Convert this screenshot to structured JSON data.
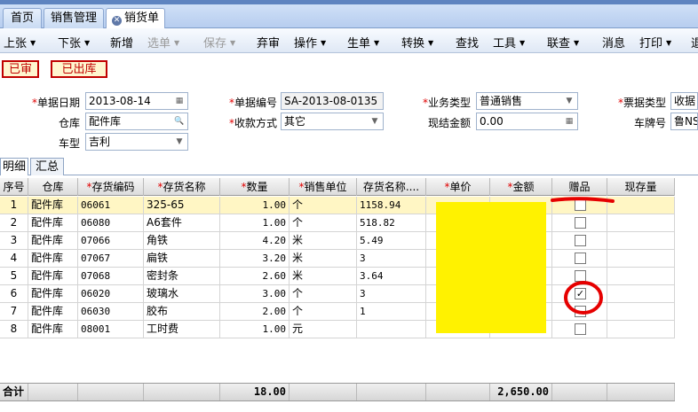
{
  "tabs": [
    {
      "label": "首页"
    },
    {
      "label": "销售管理"
    },
    {
      "label": "销货单"
    }
  ],
  "toolbar": [
    {
      "label": "上张",
      "dropdown": true,
      "disabled": false
    },
    {
      "label": "下张",
      "dropdown": true,
      "disabled": false
    },
    {
      "label": "新增",
      "dropdown": false,
      "disabled": false
    },
    {
      "label": "选单",
      "dropdown": true,
      "disabled": true
    },
    {
      "label": "保存",
      "dropdown": true,
      "disabled": true
    },
    {
      "label": "弃审",
      "dropdown": false,
      "disabled": false
    },
    {
      "label": "操作",
      "dropdown": true,
      "disabled": false
    },
    {
      "label": "生单",
      "dropdown": true,
      "disabled": false
    },
    {
      "label": "转换",
      "dropdown": true,
      "disabled": false
    },
    {
      "label": "查找",
      "dropdown": false,
      "disabled": false
    },
    {
      "label": "工具",
      "dropdown": true,
      "disabled": false
    },
    {
      "label": "联查",
      "dropdown": true,
      "disabled": false
    },
    {
      "label": "消息",
      "dropdown": false,
      "disabled": false
    },
    {
      "label": "打印",
      "dropdown": true,
      "disabled": false
    },
    {
      "label": "退",
      "dropdown": false,
      "disabled": false
    }
  ],
  "stamps": {
    "audited": "已审",
    "shipped": "已出库"
  },
  "form": {
    "doc_date": {
      "label": "单据日期",
      "value": "2013-08-14"
    },
    "doc_no": {
      "label": "单据编号",
      "value": "SA-2013-08-0135"
    },
    "biz_type": {
      "label": "业务类型",
      "value": "普通销售"
    },
    "invoice_type": {
      "label": "票据类型",
      "value": "收据"
    },
    "warehouse": {
      "label": "仓库",
      "value": "配件库"
    },
    "payment": {
      "label": "收款方式",
      "value": "其它"
    },
    "cash_amount": {
      "label": "现结金额",
      "value": "0.00"
    },
    "plate": {
      "label": "车牌号",
      "value": "鲁NS"
    },
    "car_model": {
      "label": "车型",
      "value": "吉利"
    }
  },
  "subtabs": [
    {
      "label": "明细"
    },
    {
      "label": "汇总"
    }
  ],
  "columns": [
    "序号",
    "仓库",
    "存货编码",
    "存货名称",
    "数量",
    "销售单位",
    "存货名称....",
    "单价",
    "金额",
    "赠品",
    "现存量"
  ],
  "rows": [
    {
      "no": "1",
      "wh": "配件库",
      "code": "06061",
      "name": "325-65",
      "qty": "1.00",
      "unit": "个",
      "name2": "1158.94",
      "gift": false
    },
    {
      "no": "2",
      "wh": "配件库",
      "code": "06080",
      "name": "A6套件",
      "qty": "1.00",
      "unit": "个",
      "name2": "518.82",
      "gift": false
    },
    {
      "no": "3",
      "wh": "配件库",
      "code": "07066",
      "name": "角铁",
      "qty": "4.20",
      "unit": "米",
      "name2": "5.49",
      "gift": false
    },
    {
      "no": "4",
      "wh": "配件库",
      "code": "07067",
      "name": "扁铁",
      "qty": "3.20",
      "unit": "米",
      "name2": "3",
      "gift": false
    },
    {
      "no": "5",
      "wh": "配件库",
      "code": "07068",
      "name": "密封条",
      "qty": "2.60",
      "unit": "米",
      "name2": "3.64",
      "gift": false
    },
    {
      "no": "6",
      "wh": "配件库",
      "code": "06020",
      "name": "玻璃水",
      "qty": "3.00",
      "unit": "个",
      "name2": "3",
      "gift": true
    },
    {
      "no": "7",
      "wh": "配件库",
      "code": "06030",
      "name": "胶布",
      "qty": "2.00",
      "unit": "个",
      "name2": "1",
      "gift": false
    },
    {
      "no": "8",
      "wh": "配件库",
      "code": "08001",
      "name": "工时费",
      "qty": "1.00",
      "unit": "元",
      "name2": "",
      "gift": false
    }
  ],
  "totals": {
    "label": "合计",
    "qty": "18.00",
    "amount": "2,650.00"
  },
  "colors": {
    "accent_red": "#e00000",
    "redaction_yellow": "#fff200",
    "selected_row": "#fff6c4"
  }
}
